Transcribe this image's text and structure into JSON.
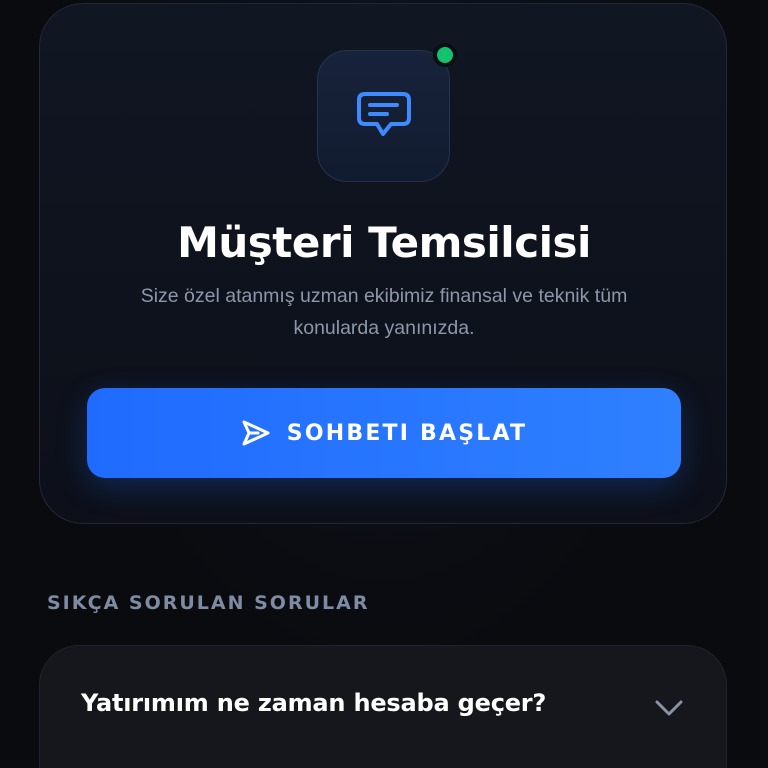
{
  "support_card": {
    "title": "Müşteri Temsilcisi",
    "description": "Size özel atanmış uzman ekibimiz finansal ve teknik tüm konularda yanınızda.",
    "icon": "chat-bubble-icon",
    "status": "online",
    "status_color": "#12c26c",
    "cta": {
      "label": "SOHBETI BAŞLAT",
      "icon": "send-icon",
      "color": "#1f6bff"
    }
  },
  "faq": {
    "heading": "SIKÇA SORULAN SORULAR",
    "items": [
      {
        "question": "Yatırımım ne zaman hesaba geçer?",
        "expanded": false
      }
    ]
  },
  "colors": {
    "accent": "#1f6bff",
    "background": "#0a0b0f",
    "muted_text": "#8e97a9"
  }
}
